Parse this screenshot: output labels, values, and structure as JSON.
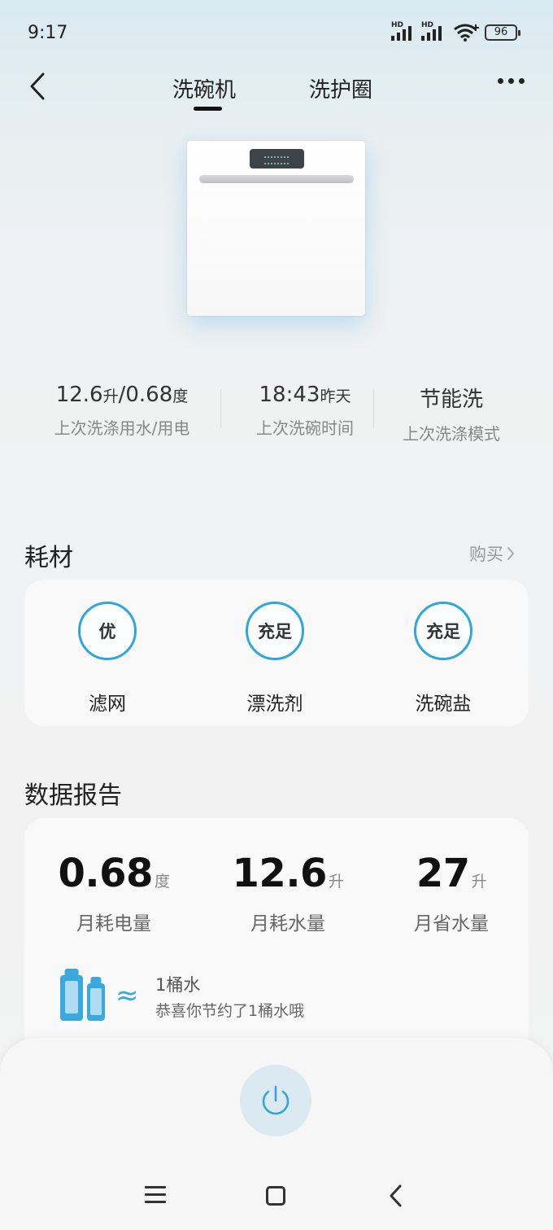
{
  "status_bar": {
    "time": "9:17",
    "battery": "96",
    "signal_label": "HD"
  },
  "nav": {
    "tabs": [
      {
        "label": "洗碗机",
        "active": true
      },
      {
        "label": "洗护圈",
        "active": false
      }
    ]
  },
  "last_wash": {
    "usage_value": "12.6",
    "usage_unit1": "升",
    "usage_sep": "/0.68",
    "usage_unit2": "度",
    "usage_label": "上次洗涤用水/用电",
    "time_value": "18:43",
    "time_suffix": "昨天",
    "time_label": "上次洗碗时间",
    "mode_value": "节能洗",
    "mode_label": "上次洗涤模式"
  },
  "consumables": {
    "title": "耗材",
    "buy_label": "购买",
    "items": [
      {
        "status": "优",
        "label": "滤网"
      },
      {
        "status": "充足",
        "label": "漂洗剂"
      },
      {
        "status": "充足",
        "label": "洗碗盐"
      }
    ]
  },
  "report": {
    "title": "数据报告",
    "metrics": [
      {
        "value": "0.68",
        "unit": "度",
        "label": "月耗电量"
      },
      {
        "value": "12.6",
        "unit": "升",
        "label": "月耗水量"
      },
      {
        "value": "27",
        "unit": "升",
        "label": "月省水量"
      }
    ],
    "saving_title": "1桶水",
    "saving_subtitle": "恭喜你节约了1桶水哦",
    "approx_symbol": "≈"
  },
  "colors": {
    "accent": "#2fa7dc",
    "water": "#39a9de"
  }
}
